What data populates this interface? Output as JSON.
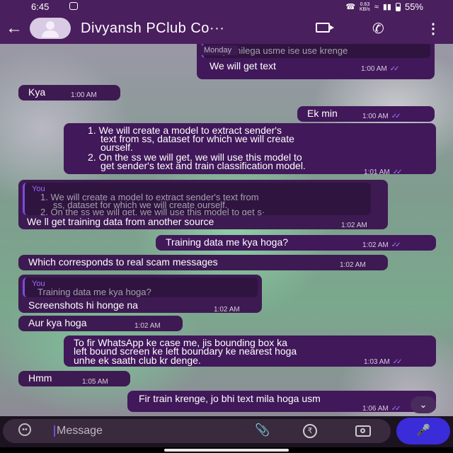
{
  "status_bar": {
    "time": "6:45",
    "net_speed_value": "0.63",
    "net_speed_unit": "KB/s",
    "battery": "55%"
  },
  "app_bar": {
    "title": "Divyansh PClub Co···",
    "icons": [
      "back-arrow-icon",
      "avatar",
      "video-call-icon",
      "phone-call-icon",
      "more-vert-icon"
    ]
  },
  "chat": {
    "day_chip": "Monday",
    "messages": [
      {
        "dir": "out",
        "lines": [
          "Fir jo milega usme ise use krenge"
        ],
        "quoted": true,
        "partial_top": true,
        "extra": "We will get text",
        "time": "1:00 AM",
        "ticks": true
      },
      {
        "dir": "in",
        "lines": [
          "Kya"
        ],
        "time": "1:00 AM"
      },
      {
        "dir": "out",
        "lines": [
          "Ek min"
        ],
        "time": "1:00 AM",
        "ticks": true
      },
      {
        "dir": "out",
        "lines": [
          "1. We will create a model to extract sender's",
          "text from ss, dataset for which we will create",
          "ourself.",
          "2. On the ss we will get, we will use this model to",
          "get sender's text and train classification model."
        ],
        "time": "1:01 AM",
        "ticks": true
      },
      {
        "dir": "in",
        "quote_name": "You",
        "quote_lines": [
          "1. We will create a model to extract sender's text from",
          "ss, dataset for which we will create ourself.",
          "2. On the ss we will get, we will use this model to get s·"
        ],
        "lines": [
          "We ll get training data from another source"
        ],
        "time": "1:02 AM"
      },
      {
        "dir": "out",
        "lines": [
          "Training data me kya hoga?"
        ],
        "time": "1:02 AM",
        "ticks": true
      },
      {
        "dir": "in",
        "lines": [
          "Which corresponds to real scam messages"
        ],
        "time": "1:02 AM"
      },
      {
        "dir": "in",
        "quote_name": "You",
        "quote_lines": [
          "Training data me kya hoga?"
        ],
        "lines": [
          "Screenshots hi honge na"
        ],
        "time": "1:02 AM"
      },
      {
        "dir": "in",
        "lines": [
          "Aur kya hoga"
        ],
        "time": "1:02 AM"
      },
      {
        "dir": "out",
        "lines": [
          "To fir WhatsApp ke case me, jis bounding box ka",
          "left bound screen ke left boundary ke nearest hoga",
          "unhe ek saath club kr denge."
        ],
        "time": "1:03 AM",
        "ticks": true
      },
      {
        "dir": "in",
        "lines": [
          "Hmm"
        ],
        "time": "1:05 AM"
      },
      {
        "dir": "out",
        "lines": [
          "Fir train krenge, jo bhi text mila hoga usm"
        ],
        "time": "1:06 AM",
        "ticks": true
      }
    ]
  },
  "input_bar": {
    "placeholder": "Message",
    "icons": [
      "emoji-icon",
      "attach-icon",
      "rupee-payment-icon",
      "camera-icon",
      "mic-icon"
    ]
  },
  "colors": {
    "app_bar_bg": "#4a1f5e",
    "bubble_bg": "#3e1a52",
    "read_ticks": "#a77bff",
    "mic_button": "#3a2cd8"
  }
}
